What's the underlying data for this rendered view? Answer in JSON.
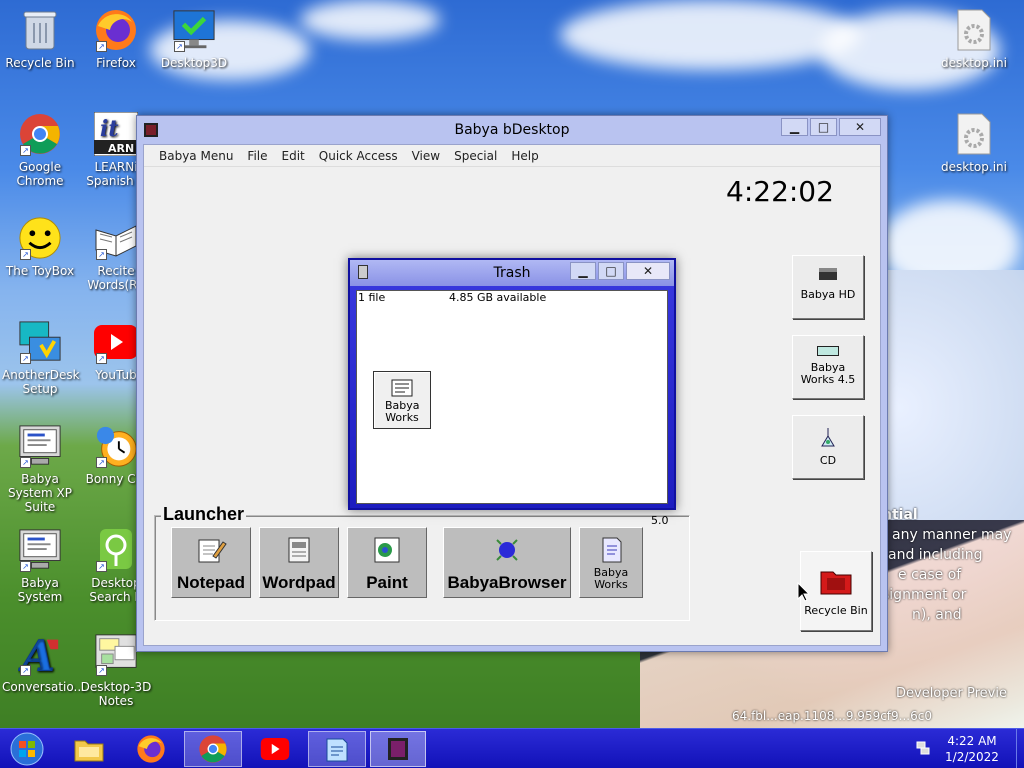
{
  "desktop": {
    "icons_left": [
      {
        "label": "Recycle Bin",
        "icon": "recycle-bin-icon"
      },
      {
        "label": "Firefox",
        "icon": "firefox-icon"
      },
      {
        "label": "Desktop3D",
        "icon": "desktop3d-icon"
      },
      {
        "label": "Google Chrome",
        "icon": "chrome-icon"
      },
      {
        "label": "LEARNi Spanish V",
        "icon": "learn-spanish-icon"
      },
      {
        "label": "The ToyBox",
        "icon": "smiley-icon"
      },
      {
        "label": "Recite Words(Ru",
        "icon": "book-icon"
      },
      {
        "label": "AnotherDesk Setup",
        "icon": "setup-icon"
      },
      {
        "label": "YouTub",
        "icon": "youtube-icon"
      },
      {
        "label": "Babya System XP Suite",
        "icon": "computer-icon"
      },
      {
        "label": "Bonny Clo",
        "icon": "clock-icon"
      },
      {
        "label": "Babya System",
        "icon": "computer-icon"
      },
      {
        "label": "Desktop Search B",
        "icon": "search-icon"
      },
      {
        "label": "Conversatio...",
        "icon": "letter-a-icon"
      },
      {
        "label": "Desktop-3D Notes",
        "icon": "notes-icon"
      }
    ],
    "icons_right": [
      {
        "label": "desktop.ini",
        "icon": "settings-file-icon"
      },
      {
        "label": "desktop.ini",
        "icon": "settings-file-icon"
      }
    ],
    "overlay_fragments": [
      "ntial",
      "any manner may",
      "and including",
      "e case of",
      "signment or",
      "n), and",
      "Developer Previe",
      "64.fbl...eap.1108...9.959cf9...6c0"
    ]
  },
  "main_window": {
    "title": "Babya bDesktop",
    "controls": {
      "minimize": "▁",
      "maximize": "□",
      "close": "✕"
    },
    "menu": [
      "Babya Menu",
      "File",
      "Edit",
      "Quick Access",
      "View",
      "Special",
      "Help"
    ],
    "clock": "4:22:02",
    "drives": [
      {
        "label": "Babya HD",
        "icon": "hard-drive-icon"
      },
      {
        "label": "Babya Works 4.5",
        "icon": "disk-drive-icon"
      },
      {
        "label": "CD",
        "icon": "cd-icon"
      }
    ],
    "recycle_bin": {
      "label": "Recycle Bin"
    },
    "launcher": {
      "title": "Launcher",
      "version": "5.0",
      "buttons": [
        {
          "label": "Notepad"
        },
        {
          "label": "Wordpad"
        },
        {
          "label": "Paint"
        },
        {
          "label": "BabyaBrowser"
        },
        {
          "label": "Babya Works"
        }
      ]
    }
  },
  "trash_window": {
    "title": "Trash",
    "file_count": "1 file",
    "available": "4.85 GB available",
    "items": [
      {
        "label": "Babya Works"
      }
    ]
  },
  "taskbar": {
    "time": "4:22 AM",
    "date": "1/2/2022",
    "apps": [
      "start-orb-icon",
      "file-explorer-icon",
      "firefox-icon",
      "chrome-icon",
      "youtube-icon",
      "notepad-icon",
      "babya-icon"
    ]
  },
  "colors": {
    "taskbar": "#1a1ac4",
    "window_frame": "#b9c3f0",
    "trash_frame": "#2a2ad8",
    "launcher_button": "#bdbdbd"
  }
}
